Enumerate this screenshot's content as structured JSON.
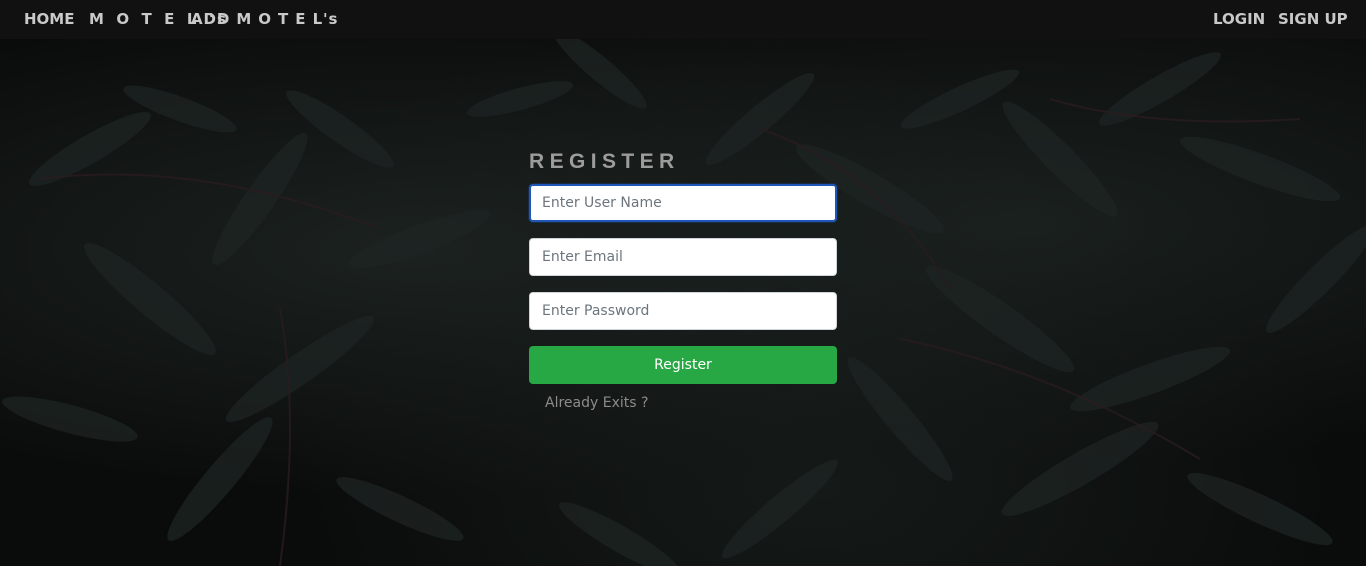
{
  "navbar": {
    "home": "HOME",
    "motels": "M O T E L 's",
    "add_motel": "ADD M O T E L's",
    "login": "LOGIN",
    "signup": "SIGN UP"
  },
  "form": {
    "title": "REGISTER",
    "username_placeholder": "Enter User Name",
    "email_placeholder": "Enter Email",
    "password_placeholder": "Enter Password",
    "submit_label": "Register",
    "already_link": "Already Exits ?"
  },
  "colors": {
    "navbar_bg": "#111111",
    "button_green": "#28a745",
    "focus_border": "#1f57b8",
    "background": "#0a0c0b"
  },
  "icons": {
    "background_image": "dark-fern-leaves"
  }
}
